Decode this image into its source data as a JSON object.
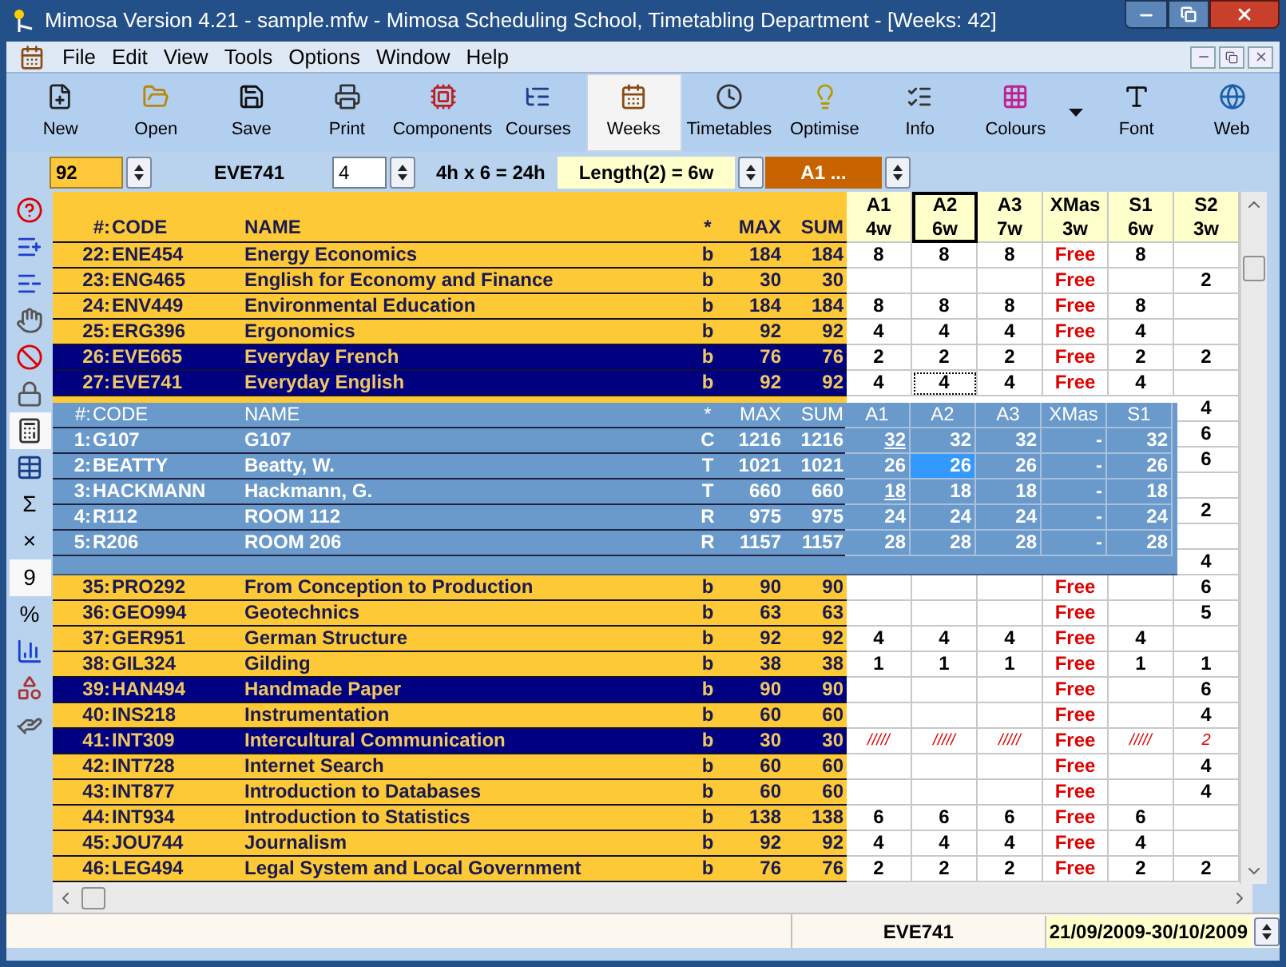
{
  "window": {
    "title": "Mimosa Version 4.21 - sample.mfw - Mimosa Scheduling School, Timetabling Department - [Weeks: 42]"
  },
  "menu": [
    "File",
    "Edit",
    "View",
    "Tools",
    "Options",
    "Window",
    "Help"
  ],
  "toolbar": [
    {
      "label": "New",
      "kind": "new",
      "selected": false
    },
    {
      "label": "Open",
      "kind": "open",
      "selected": false
    },
    {
      "label": "Save",
      "kind": "save",
      "selected": false
    },
    {
      "label": "Print",
      "kind": "print",
      "selected": false
    },
    {
      "label": "Components",
      "kind": "components",
      "selected": false
    },
    {
      "label": "Courses",
      "kind": "courses",
      "selected": false
    },
    {
      "label": "Weeks",
      "kind": "weeks",
      "selected": true
    },
    {
      "label": "Timetables",
      "kind": "timetables",
      "selected": false
    },
    {
      "label": "Optimise",
      "kind": "optimise",
      "selected": false
    },
    {
      "label": "Info",
      "kind": "info",
      "selected": false
    },
    {
      "label": "Colours",
      "kind": "colours",
      "selected": false
    },
    {
      "kind": "caret",
      "selected": false
    },
    {
      "label": "Font",
      "kind": "font",
      "selected": false
    },
    {
      "label": "Web",
      "kind": "web",
      "selected": false
    }
  ],
  "inputs": {
    "number": "92",
    "code": "EVE741",
    "hours": "4",
    "formula": "4h x 6 = 24h",
    "length": "Length(2) = 6w",
    "week_choice": "A1 ..."
  },
  "sidebar": [
    {
      "kind": "help",
      "selected": false
    },
    {
      "kind": "add",
      "selected": false
    },
    {
      "kind": "remove",
      "selected": false
    },
    {
      "kind": "point",
      "selected": false
    },
    {
      "kind": "ban",
      "selected": false
    },
    {
      "kind": "lock",
      "selected": false
    },
    {
      "kind": "calculator",
      "selected": true
    },
    {
      "kind": "table",
      "selected": false
    },
    {
      "kind": "glyph",
      "text": "Σ",
      "selected": false
    },
    {
      "kind": "glyph",
      "text": "×",
      "selected": false
    },
    {
      "kind": "glyph",
      "text": "9",
      "selected": true
    },
    {
      "kind": "glyph",
      "text": "%",
      "selected": false
    },
    {
      "kind": "chart",
      "selected": false
    },
    {
      "kind": "shapes",
      "selected": false
    },
    {
      "kind": "hand",
      "selected": false
    }
  ],
  "grid": {
    "columns": [
      "#:",
      "CODE",
      "NAME",
      "*",
      "MAX",
      "SUM"
    ],
    "weeks": [
      {
        "name": "A1",
        "length": "4w",
        "kind": "term",
        "selected": false
      },
      {
        "name": "A2",
        "length": "6w",
        "kind": "term",
        "selected": true
      },
      {
        "name": "A3",
        "length": "7w",
        "kind": "term",
        "selected": false
      },
      {
        "name": "XMas",
        "length": "3w",
        "kind": "holiday",
        "selected": false
      },
      {
        "name": "S1",
        "length": "6w",
        "kind": "term",
        "selected": false
      },
      {
        "name": "S2",
        "length": "3w",
        "kind": "term",
        "selected": false
      }
    ],
    "rows": [
      {
        "kind": "course",
        "number": "22:",
        "code": "ENE454",
        "name": "Energy Economics",
        "type": "b",
        "max": "184",
        "sum": "184",
        "selected": false,
        "blocked": false,
        "focused": false,
        "weeks": {
          "a1": "8",
          "a2": "8",
          "a3": "8",
          "xmas": "Free",
          "s1": "8"
        }
      },
      {
        "kind": "course",
        "number": "23:",
        "code": "ENG465",
        "name": "English for Economy and Finance",
        "type": "b",
        "max": "30",
        "sum": "30",
        "selected": false,
        "blocked": false,
        "focused": false,
        "weeks": {
          "xmas": "Free",
          "s2": "2"
        }
      },
      {
        "kind": "course",
        "number": "24:",
        "code": "ENV449",
        "name": "Environmental Education",
        "type": "b",
        "max": "184",
        "sum": "184",
        "selected": false,
        "blocked": false,
        "focused": false,
        "weeks": {
          "a1": "8",
          "a2": "8",
          "a3": "8",
          "xmas": "Free",
          "s1": "8"
        }
      },
      {
        "kind": "course",
        "number": "25:",
        "code": "ERG396",
        "name": "Ergonomics",
        "type": "b",
        "max": "92",
        "sum": "92",
        "selected": false,
        "blocked": false,
        "focused": false,
        "weeks": {
          "a1": "4",
          "a2": "4",
          "a3": "4",
          "xmas": "Free",
          "s1": "4"
        }
      },
      {
        "kind": "course",
        "number": "26:",
        "code": "EVE665",
        "name": "Everyday French",
        "type": "b",
        "max": "76",
        "sum": "76",
        "selected": true,
        "blocked": false,
        "focused": false,
        "weeks": {
          "a1": "2",
          "a2": "2",
          "a3": "2",
          "xmas": "Free",
          "s1": "2",
          "s2": "2"
        }
      },
      {
        "kind": "course",
        "number": "27:",
        "code": "EVE741",
        "name": "Everyday English",
        "type": "b",
        "max": "92",
        "sum": "92",
        "selected": true,
        "blocked": false,
        "focused": true,
        "weeks": {
          "a1": "4",
          "a2": "4",
          "a3": "4",
          "xmas": "Free",
          "s1": "4"
        }
      },
      {
        "kind": "covered",
        "weeks": {
          "s2": "4"
        }
      },
      {
        "kind": "covered",
        "weeks": {
          "s2": "6"
        }
      },
      {
        "kind": "covered",
        "weeks": {
          "s2": "6"
        }
      },
      {
        "kind": "covered"
      },
      {
        "kind": "covered",
        "weeks": {
          "s2": "2"
        }
      },
      {
        "kind": "covered"
      },
      {
        "kind": "covered",
        "weeks": {
          "s2": "4"
        }
      },
      {
        "kind": "course",
        "number": "35:",
        "code": "PRO292",
        "name": "From Conception to Production",
        "type": "b",
        "max": "90",
        "sum": "90",
        "selected": false,
        "blocked": false,
        "focused": false,
        "weeks": {
          "xmas": "Free",
          "s2": "6"
        }
      },
      {
        "kind": "course",
        "number": "36:",
        "code": "GEO994",
        "name": "Geotechnics",
        "type": "b",
        "max": "63",
        "sum": "63",
        "selected": false,
        "blocked": false,
        "focused": false,
        "weeks": {
          "xmas": "Free",
          "s2": "5"
        }
      },
      {
        "kind": "course",
        "number": "37:",
        "code": "GER951",
        "name": "German Structure",
        "type": "b",
        "max": "92",
        "sum": "92",
        "selected": false,
        "blocked": false,
        "focused": false,
        "weeks": {
          "a1": "4",
          "a2": "4",
          "a3": "4",
          "xmas": "Free",
          "s1": "4"
        }
      },
      {
        "kind": "course",
        "number": "38:",
        "code": "GIL324",
        "name": "Gilding",
        "type": "b",
        "max": "38",
        "sum": "38",
        "selected": false,
        "blocked": false,
        "focused": false,
        "weeks": {
          "a1": "1",
          "a2": "1",
          "a3": "1",
          "xmas": "Free",
          "s1": "1",
          "s2": "1"
        }
      },
      {
        "kind": "course",
        "number": "39:",
        "code": "HAN494",
        "name": "Handmade Paper",
        "type": "b",
        "max": "90",
        "sum": "90",
        "selected": true,
        "blocked": false,
        "focused": false,
        "weeks": {
          "xmas": "Free",
          "s2": "6"
        }
      },
      {
        "kind": "course",
        "number": "40:",
        "code": "INS218",
        "name": "Instrumentation",
        "type": "b",
        "max": "60",
        "sum": "60",
        "selected": false,
        "blocked": false,
        "focused": false,
        "weeks": {
          "xmas": "Free",
          "s2": "4"
        }
      },
      {
        "kind": "course",
        "number": "41:",
        "code": "INT309",
        "name": "Intercultural Communication",
        "type": "b",
        "max": "30",
        "sum": "30",
        "selected": true,
        "blocked": true,
        "focused": false,
        "weeks": {
          "a1": "/////",
          "a2": "/////",
          "a3": "/////",
          "xmas": "Free",
          "s1": "/////",
          "s2": "2"
        }
      },
      {
        "kind": "course",
        "number": "42:",
        "code": "INT728",
        "name": "Internet Search",
        "type": "b",
        "max": "60",
        "sum": "60",
        "selected": false,
        "blocked": false,
        "focused": false,
        "weeks": {
          "xmas": "Free",
          "s2": "4"
        }
      },
      {
        "kind": "course",
        "number": "43:",
        "code": "INT877",
        "name": "Introduction to Databases",
        "type": "b",
        "max": "60",
        "sum": "60",
        "selected": false,
        "blocked": false,
        "focused": false,
        "weeks": {
          "xmas": "Free",
          "s2": "4"
        }
      },
      {
        "kind": "course",
        "number": "44:",
        "code": "INT934",
        "name": "Introduction to Statistics",
        "type": "b",
        "max": "138",
        "sum": "138",
        "selected": false,
        "blocked": false,
        "focused": false,
        "weeks": {
          "a1": "6",
          "a2": "6",
          "a3": "6",
          "xmas": "Free",
          "s1": "6"
        }
      },
      {
        "kind": "course",
        "number": "45:",
        "code": "JOU744",
        "name": "Journalism",
        "type": "b",
        "max": "92",
        "sum": "92",
        "selected": false,
        "blocked": false,
        "focused": false,
        "weeks": {
          "a1": "4",
          "a2": "4",
          "a3": "4",
          "xmas": "Free",
          "s1": "4"
        }
      },
      {
        "kind": "course",
        "number": "46:",
        "code": "LEG494",
        "name": "Legal System and Local Government",
        "type": "b",
        "max": "76",
        "sum": "76",
        "selected": false,
        "blocked": false,
        "focused": false,
        "weeks": {
          "a1": "2",
          "a2": "2",
          "a3": "2",
          "xmas": "Free",
          "s1": "2",
          "s2": "2"
        }
      }
    ]
  },
  "popup": {
    "columns": [
      "#:",
      "CODE",
      "NAME",
      "*",
      "MAX",
      "SUM"
    ],
    "weeks": [
      "A1",
      "A2",
      "A3",
      "XMas",
      "S1"
    ],
    "rows": [
      {
        "number": "1:",
        "code": "G107",
        "name": "G107",
        "type": "C",
        "max": "1216",
        "sum": "1216",
        "weeks": [
          {
            "value": "32",
            "underlined": true,
            "selected": false
          },
          {
            "value": "32",
            "underlined": false,
            "selected": false
          },
          {
            "value": "32",
            "underlined": false,
            "selected": false
          },
          {
            "value": "-",
            "underlined": false,
            "selected": false
          },
          {
            "value": "32",
            "underlined": false,
            "selected": false
          }
        ]
      },
      {
        "number": "2:",
        "code": "BEATTY",
        "name": "Beatty, W.",
        "type": "T",
        "max": "1021",
        "sum": "1021",
        "weeks": [
          {
            "value": "26",
            "underlined": false,
            "selected": false
          },
          {
            "value": "26",
            "underlined": false,
            "selected": true
          },
          {
            "value": "26",
            "underlined": false,
            "selected": false
          },
          {
            "value": "-",
            "underlined": false,
            "selected": false
          },
          {
            "value": "26",
            "underlined": false,
            "selected": false
          }
        ]
      },
      {
        "number": "3:",
        "code": "HACKMANN",
        "name": "Hackmann, G.",
        "type": "T",
        "max": "660",
        "sum": "660",
        "weeks": [
          {
            "value": "18",
            "underlined": true,
            "selected": false
          },
          {
            "value": "18",
            "underlined": false,
            "selected": false
          },
          {
            "value": "18",
            "underlined": false,
            "selected": false
          },
          {
            "value": "-",
            "underlined": false,
            "selected": false
          },
          {
            "value": "18",
            "underlined": false,
            "selected": false
          }
        ]
      },
      {
        "number": "4:",
        "code": "R112",
        "name": "ROOM 112",
        "type": "R",
        "max": "975",
        "sum": "975",
        "weeks": [
          {
            "value": "24",
            "underlined": false,
            "selected": false
          },
          {
            "value": "24",
            "underlined": false,
            "selected": false
          },
          {
            "value": "24",
            "underlined": false,
            "selected": false
          },
          {
            "value": "-",
            "underlined": false,
            "selected": false
          },
          {
            "value": "24",
            "underlined": false,
            "selected": false
          }
        ]
      },
      {
        "number": "5:",
        "code": "R206",
        "name": "ROOM 206",
        "type": "R",
        "max": "1157",
        "sum": "1157",
        "weeks": [
          {
            "value": "28",
            "underlined": false,
            "selected": false
          },
          {
            "value": "28",
            "underlined": false,
            "selected": false
          },
          {
            "value": "28",
            "underlined": false,
            "selected": false
          },
          {
            "value": "-",
            "underlined": false,
            "selected": false
          },
          {
            "value": "28",
            "underlined": false,
            "selected": false
          }
        ]
      }
    ]
  },
  "status_bar": {
    "code": "EVE741",
    "dates": "21/09/2009-30/10/2009"
  }
}
